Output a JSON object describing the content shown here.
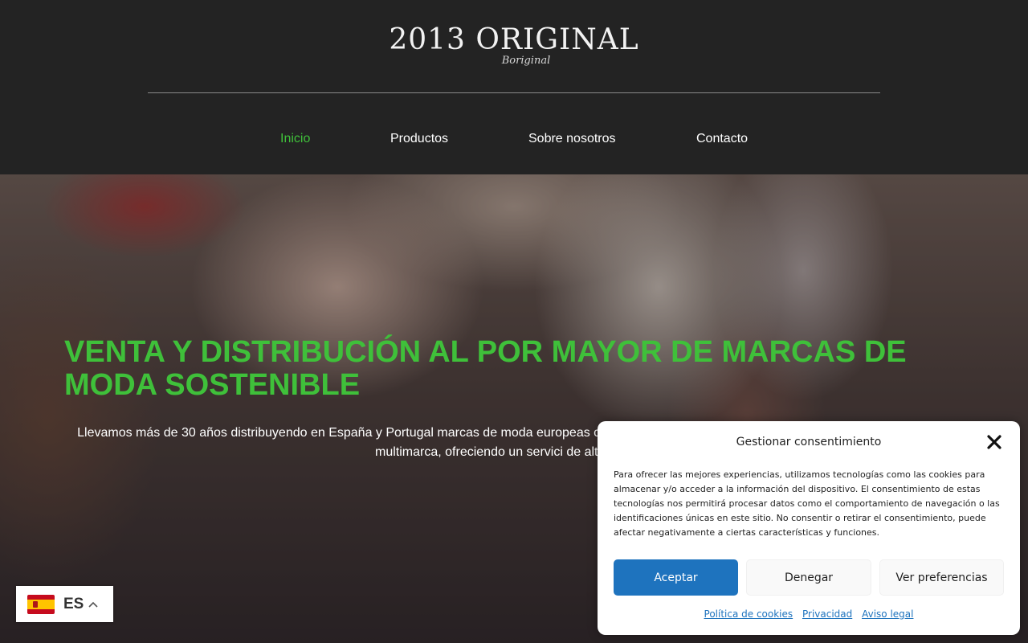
{
  "logo": {
    "main": "2013 ORIGINAL",
    "sub": "Boriginal"
  },
  "nav": {
    "items": [
      {
        "label": "Inicio",
        "active": true
      },
      {
        "label": "Productos",
        "active": false
      },
      {
        "label": "Sobre nosotros",
        "active": false
      },
      {
        "label": "Contacto",
        "active": false
      }
    ]
  },
  "hero": {
    "title": "VENTA Y DISTRIBUCIÓN AL POR MAYOR DE MARCAS DE MODA SOSTENIBLE",
    "text": "Llevamos más de 30 años distribuyendo en España y Portugal marcas de moda europeas co sostenible. Desde 2013 trabajamos con las mejores tiendas multimarca, ofreciendo un servici de alta calidad."
  },
  "language": {
    "code": "ES",
    "flag": "spain-flag-icon"
  },
  "consent": {
    "title": "Gestionar consentimiento",
    "body": "Para ofrecer las mejores experiencias, utilizamos tecnologías como las cookies para almacenar y/o acceder a la información del dispositivo. El consentimiento de estas tecnologías nos permitirá procesar datos como el comportamiento de navegación o las identificaciones únicas en este sitio. No consentir o retirar el consentimiento, puede afectar negativamente a ciertas características y funciones.",
    "accept": "Aceptar",
    "deny": "Denegar",
    "prefs": "Ver preferencias",
    "links": [
      "Política de cookies",
      "Privacidad",
      "Aviso legal"
    ]
  },
  "colors": {
    "accent": "#3fc03a",
    "header_bg": "#232323",
    "button_blue": "#1e73be"
  }
}
